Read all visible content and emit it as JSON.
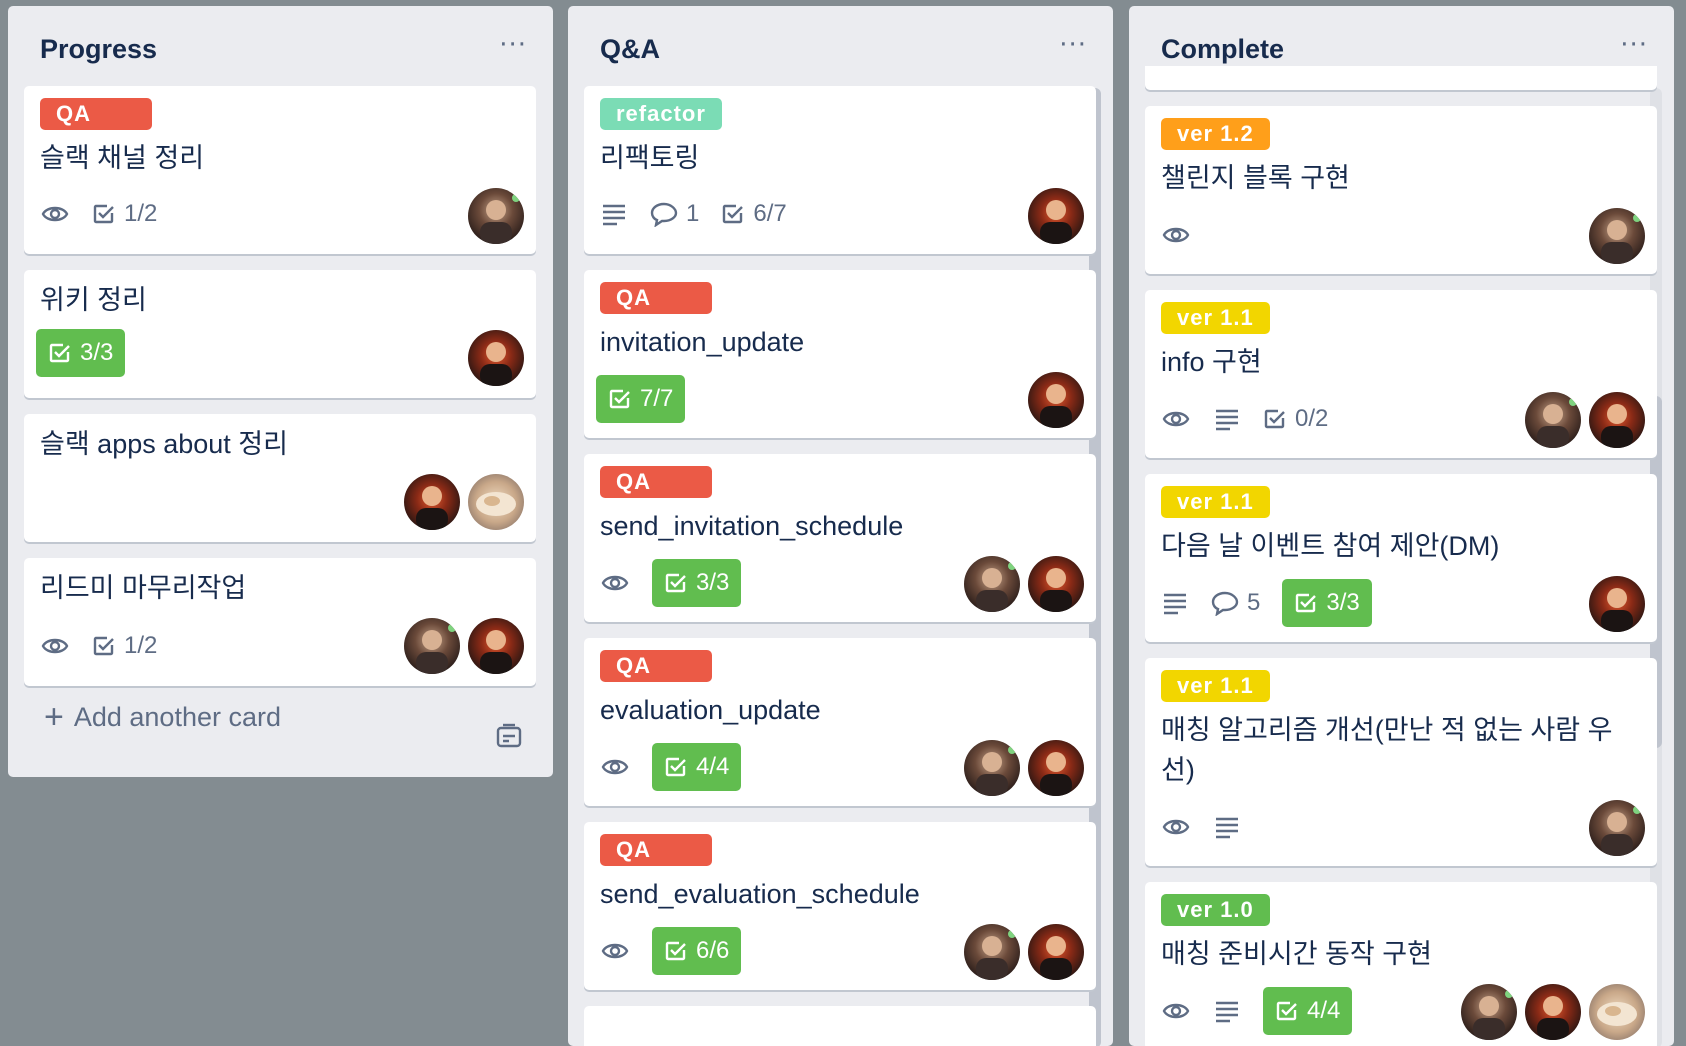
{
  "colors": {
    "board_bg": "#838c91",
    "list_bg": "#ebecf0",
    "qa": "#eb5a46",
    "refactor": "#7bdcb5",
    "ver12": "#ff9f1a",
    "ver11": "#f2d600",
    "ver10": "#61bd4f",
    "done_badge": "#61bd4f"
  },
  "lists": [
    {
      "title": "Progress",
      "menu": "···",
      "cards": [
        {
          "label": "QA",
          "title": "슬랙 채널 정리",
          "checklist": "1/2"
        },
        {
          "title": "위키 정리",
          "checklist": "3/3"
        },
        {
          "title": "슬랙 apps about 정리"
        },
        {
          "title": "리드미 마무리작업",
          "checklist": "1/2"
        }
      ],
      "add_card": "Add another card"
    },
    {
      "title": "Q&A",
      "menu": "···",
      "cards": [
        {
          "label": "refactor",
          "title": "리팩토링",
          "comments": "1",
          "checklist": "6/7"
        },
        {
          "label": "QA",
          "title": "invitation_update",
          "checklist": "7/7"
        },
        {
          "label": "QA",
          "title": "send_invitation_schedule",
          "checklist": "3/3"
        },
        {
          "label": "QA",
          "title": "evaluation_update",
          "checklist": "4/4"
        },
        {
          "label": "QA",
          "title": "send_evaluation_schedule",
          "checklist": "6/6"
        }
      ]
    },
    {
      "title": "Complete",
      "menu": "···",
      "cards": [
        {
          "label": "ver 1.2",
          "title": "챌린지 블록 구현"
        },
        {
          "label": "ver 1.1",
          "title": "info 구현",
          "checklist": "0/2"
        },
        {
          "label": "ver 1.1",
          "title": "다음 날 이벤트 참여 제안(DM)",
          "comments": "5",
          "checklist": "3/3"
        },
        {
          "label": "ver 1.1",
          "title": "매칭 알고리즘 개선(만난 적 없는 사람 우선)"
        },
        {
          "label": "ver 1.0",
          "title": "매칭 준비시간 동작 구현",
          "checklist": "4/4"
        }
      ]
    }
  ]
}
